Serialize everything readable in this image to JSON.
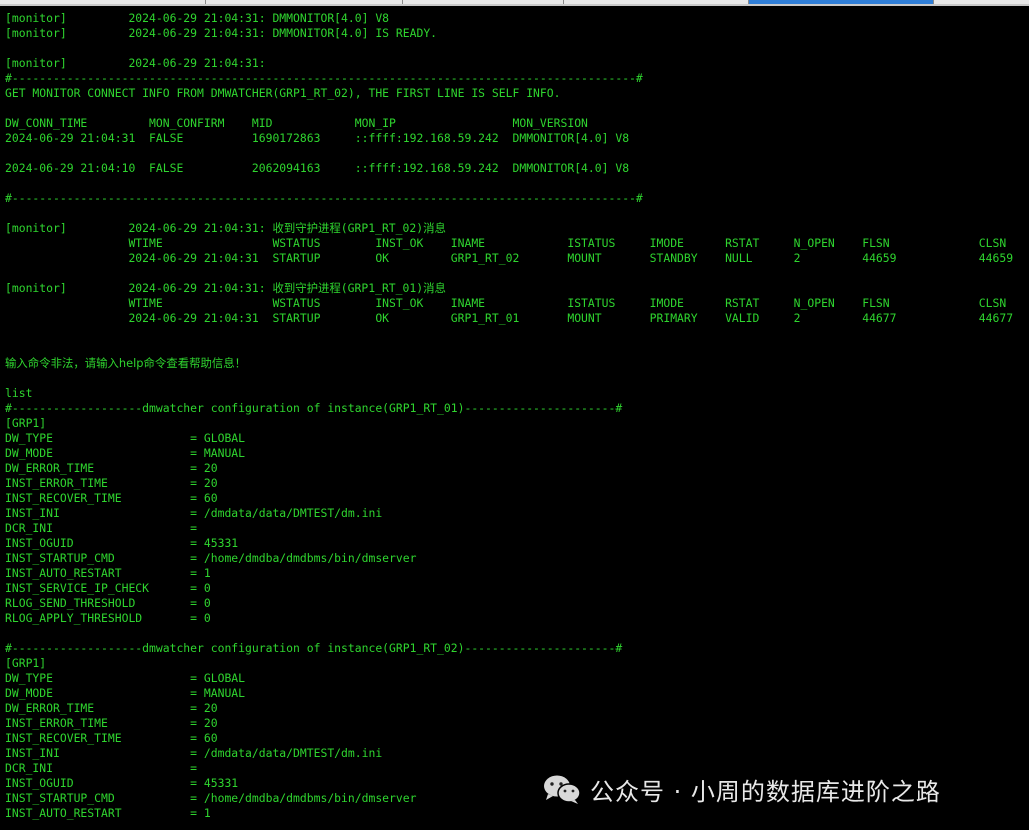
{
  "colors": {
    "background": "#000000",
    "text": "#2fd52f",
    "tab_active": "#2f7ed8",
    "watermark": "#e8e8e8"
  },
  "tabs": {
    "count": 6,
    "active_index": 4
  },
  "terminal": {
    "lines": [
      "[monitor]         2024-06-29 21:04:31: DMMONITOR[4.0] V8",
      "[monitor]         2024-06-29 21:04:31: DMMONITOR[4.0] IS READY.",
      "",
      "[monitor]         2024-06-29 21:04:31:",
      "#-------------------------------------------------------------------------------------------#",
      "GET MONITOR CONNECT INFO FROM DMWATCHER(GRP1_RT_02), THE FIRST LINE IS SELF INFO.",
      "",
      "DW_CONN_TIME         MON_CONFIRM    MID            MON_IP                 MON_VERSION",
      "2024-06-29 21:04:31  FALSE          1690172863     ::ffff:192.168.59.242  DMMONITOR[4.0] V8",
      "",
      "2024-06-29 21:04:10  FALSE          2062094163     ::ffff:192.168.59.242  DMMONITOR[4.0] V8",
      "",
      "#-------------------------------------------------------------------------------------------#",
      "",
      "[monitor]         2024-06-29 21:04:31: 收到守护进程(GRP1_RT_02)消息",
      "                  WTIME                WSTATUS        INST_OK    INAME            ISTATUS     IMODE      RSTAT     N_OPEN    FLSN             CLSN",
      "                  2024-06-29 21:04:31  STARTUP        OK         GRP1_RT_02       MOUNT       STANDBY    NULL      2         44659            44659",
      "",
      "[monitor]         2024-06-29 21:04:31: 收到守护进程(GRP1_RT_01)消息",
      "                  WTIME                WSTATUS        INST_OK    INAME            ISTATUS     IMODE      RSTAT     N_OPEN    FLSN             CLSN",
      "                  2024-06-29 21:04:31  STARTUP        OK         GRP1_RT_01       MOUNT       PRIMARY    VALID     2         44677            44677",
      "",
      "",
      "输入命令非法，请输入help命令查看帮助信息！",
      "",
      "list",
      "#-------------------dmwatcher configuration of instance(GRP1_RT_01)----------------------#",
      "[GRP1]",
      "DW_TYPE                    = GLOBAL",
      "DW_MODE                    = MANUAL",
      "DW_ERROR_TIME              = 20",
      "INST_ERROR_TIME            = 20",
      "INST_RECOVER_TIME          = 60",
      "INST_INI                   = /dmdata/data/DMTEST/dm.ini",
      "DCR_INI                    =",
      "INST_OGUID                 = 45331",
      "INST_STARTUP_CMD           = /home/dmdba/dmdbms/bin/dmserver",
      "INST_AUTO_RESTART          = 1",
      "INST_SERVICE_IP_CHECK      = 0",
      "RLOG_SEND_THRESHOLD        = 0",
      "RLOG_APPLY_THRESHOLD       = 0",
      "",
      "#-------------------dmwatcher configuration of instance(GRP1_RT_02)----------------------#",
      "[GRP1]",
      "DW_TYPE                    = GLOBAL",
      "DW_MODE                    = MANUAL",
      "DW_ERROR_TIME              = 20",
      "INST_ERROR_TIME            = 20",
      "INST_RECOVER_TIME          = 60",
      "INST_INI                   = /dmdata/data/DMTEST/dm.ini",
      "DCR_INI                    =",
      "INST_OGUID                 = 45331",
      "INST_STARTUP_CMD           = /home/dmdba/dmdbms/bin/dmserver",
      "INST_AUTO_RESTART          = 1"
    ]
  },
  "watermark": {
    "icon": "wechat-icon",
    "text": "公众号 · 小周的数据库进阶之路"
  }
}
